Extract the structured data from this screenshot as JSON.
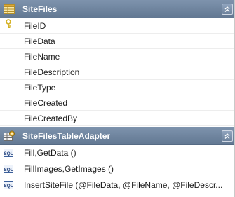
{
  "table": {
    "title": "SiteFiles",
    "table_icon": "table-grid-icon",
    "collapse_icon": "double-chevron-up-icon",
    "key_icon": "primary-key-icon",
    "columns": [
      {
        "name": "FileID",
        "primary_key": true
      },
      {
        "name": "FileData",
        "primary_key": false
      },
      {
        "name": "FileName",
        "primary_key": false
      },
      {
        "name": "FileDescription",
        "primary_key": false
      },
      {
        "name": "FileType",
        "primary_key": false
      },
      {
        "name": "FileCreated",
        "primary_key": false
      },
      {
        "name": "FileCreatedBy",
        "primary_key": false
      }
    ]
  },
  "adapter": {
    "title": "SiteFilesTableAdapter",
    "adapter_icon": "table-adapter-icon",
    "collapse_icon": "double-chevron-up-icon",
    "method_icon": "sql-query-icon",
    "methods": [
      {
        "label": "Fill,GetData ()"
      },
      {
        "label": "FillImages,GetImages ()"
      },
      {
        "label": "InsertSiteFile (@FileData, @FileName, @FileDescr..."
      }
    ]
  },
  "colors": {
    "header_top": "#7e93ad",
    "header_bottom": "#627892",
    "key_color": "#d4b020"
  }
}
